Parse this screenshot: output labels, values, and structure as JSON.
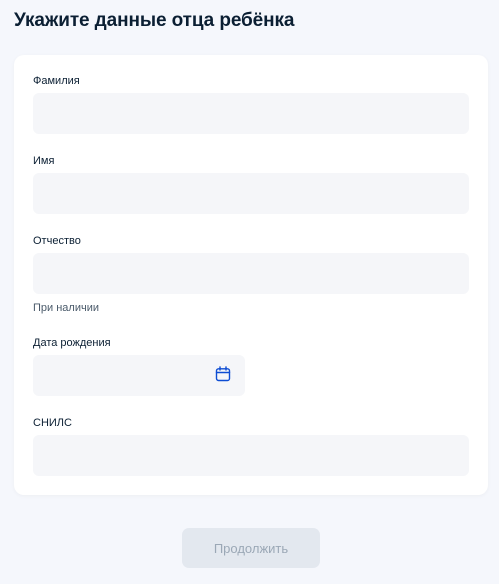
{
  "page": {
    "title": "Укажите данные отца ребёнка"
  },
  "form": {
    "surname": {
      "label": "Фамилия",
      "value": ""
    },
    "name": {
      "label": "Имя",
      "value": ""
    },
    "patronymic": {
      "label": "Отчество",
      "value": "",
      "hint": "При наличии"
    },
    "birth_date": {
      "label": "Дата рождения",
      "value": "",
      "icon": "calendar-icon"
    },
    "snils": {
      "label": "СНИЛС",
      "value": ""
    }
  },
  "actions": {
    "continue_label": "Продолжить",
    "continue_enabled": false
  },
  "colors": {
    "background": "#f5f7fc",
    "card": "#ffffff",
    "input_bg": "#f5f6f9",
    "accent": "#0d4cd3",
    "button_disabled_bg": "#e3e8ef",
    "button_disabled_text": "#9ba8b6"
  }
}
